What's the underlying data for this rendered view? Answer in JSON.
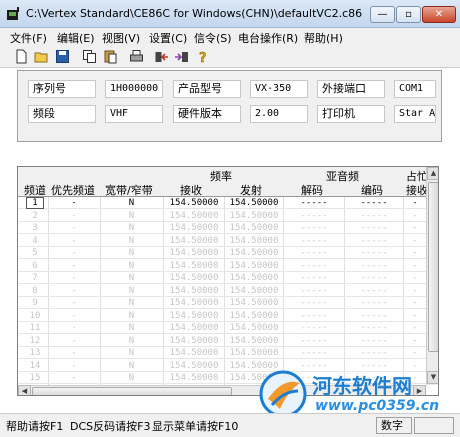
{
  "window": {
    "title": "C:\\Vertex Standard\\CE86C for Windows(CHN)\\defaultVC2.c86 - CE8...",
    "minimize": "—",
    "maximize": "▫",
    "close": "✕"
  },
  "menu": [
    "文件(F)",
    "编辑(E)",
    "视图(V)",
    "设置(C)",
    "信令(S)",
    "电台操作(R)",
    "帮助(H)"
  ],
  "toolbar": [
    "new-icon",
    "open-icon",
    "save-icon",
    "copy-icon",
    "paste-icon",
    "print-icon",
    "read-radio-icon",
    "write-radio-icon",
    "help-icon"
  ],
  "info": {
    "serial_label": "序列号",
    "serial_value": "1H000000",
    "model_label": "产品型号",
    "model_value": "VX-350",
    "port_label": "外接端口",
    "port_value": "COM1",
    "band_label": "频段",
    "band_value": "VHF",
    "hw_label": "硬件版本",
    "hw_value": "2.00",
    "printer_label": "打印机",
    "printer_value": "Star A"
  },
  "grid": {
    "group_freq": "频率",
    "group_subtone": "亚音频",
    "group_busy": "占忙",
    "col_channel": "频道",
    "col_priority": "优先频道",
    "col_bandwidth": "宽带/窄带",
    "col_rx": "接收",
    "col_tx": "发射",
    "col_decode": "解码",
    "col_encode": "编码",
    "col_busy_rx": "接收",
    "rows": [
      {
        "ch": "1",
        "pri": "-",
        "bw": "N",
        "rx": "154.50000",
        "tx": "154.50000",
        "dec": "-----",
        "enc": "-----",
        "busy": "-"
      },
      {
        "ch": "2",
        "pri": "-",
        "bw": "N",
        "rx": "154.50000",
        "tx": "154.50000",
        "dec": "-----",
        "enc": "-----",
        "busy": "-"
      },
      {
        "ch": "3",
        "pri": "-",
        "bw": "N",
        "rx": "154.50000",
        "tx": "154.50000",
        "dec": "-----",
        "enc": "-----",
        "busy": "-"
      },
      {
        "ch": "4",
        "pri": "-",
        "bw": "N",
        "rx": "154.50000",
        "tx": "154.50000",
        "dec": "-----",
        "enc": "-----",
        "busy": "-"
      },
      {
        "ch": "5",
        "pri": "-",
        "bw": "N",
        "rx": "154.50000",
        "tx": "154.50000",
        "dec": "-----",
        "enc": "-----",
        "busy": "-"
      },
      {
        "ch": "6",
        "pri": "-",
        "bw": "N",
        "rx": "154.50000",
        "tx": "154.50000",
        "dec": "-----",
        "enc": "-----",
        "busy": "-"
      },
      {
        "ch": "7",
        "pri": "-",
        "bw": "N",
        "rx": "154.50000",
        "tx": "154.50000",
        "dec": "-----",
        "enc": "-----",
        "busy": "-"
      },
      {
        "ch": "8",
        "pri": "-",
        "bw": "N",
        "rx": "154.50000",
        "tx": "154.50000",
        "dec": "-----",
        "enc": "-----",
        "busy": "-"
      },
      {
        "ch": "9",
        "pri": "-",
        "bw": "N",
        "rx": "154.50000",
        "tx": "154.50000",
        "dec": "-----",
        "enc": "-----",
        "busy": "-"
      },
      {
        "ch": "10",
        "pri": "-",
        "bw": "N",
        "rx": "154.50000",
        "tx": "154.50000",
        "dec": "-----",
        "enc": "-----",
        "busy": "-"
      },
      {
        "ch": "11",
        "pri": "-",
        "bw": "N",
        "rx": "154.50000",
        "tx": "154.50000",
        "dec": "-----",
        "enc": "-----",
        "busy": "-"
      },
      {
        "ch": "12",
        "pri": "-",
        "bw": "N",
        "rx": "154.50000",
        "tx": "154.50000",
        "dec": "-----",
        "enc": "-----",
        "busy": "-"
      },
      {
        "ch": "13",
        "pri": "-",
        "bw": "N",
        "rx": "154.50000",
        "tx": "154.50000",
        "dec": "-----",
        "enc": "-----",
        "busy": "-"
      },
      {
        "ch": "14",
        "pri": "-",
        "bw": "N",
        "rx": "154.50000",
        "tx": "154.50000",
        "dec": "-----",
        "enc": "-----",
        "busy": "-"
      },
      {
        "ch": "15",
        "pri": "-",
        "bw": "N",
        "rx": "154.50000",
        "tx": "154.50000",
        "dec": "-----",
        "enc": "-----",
        "busy": "-"
      }
    ]
  },
  "watermark": {
    "name": "河东软件网",
    "url": "www.pc0359.cn"
  },
  "status": {
    "help": "帮助请按F1",
    "dcs": "DCS反码请按F3",
    "menu": "显示菜单请按F10",
    "num": "数字"
  },
  "colors": {
    "grid_inactive": "#c6c6c6",
    "watermark": "#1c7ed1"
  }
}
